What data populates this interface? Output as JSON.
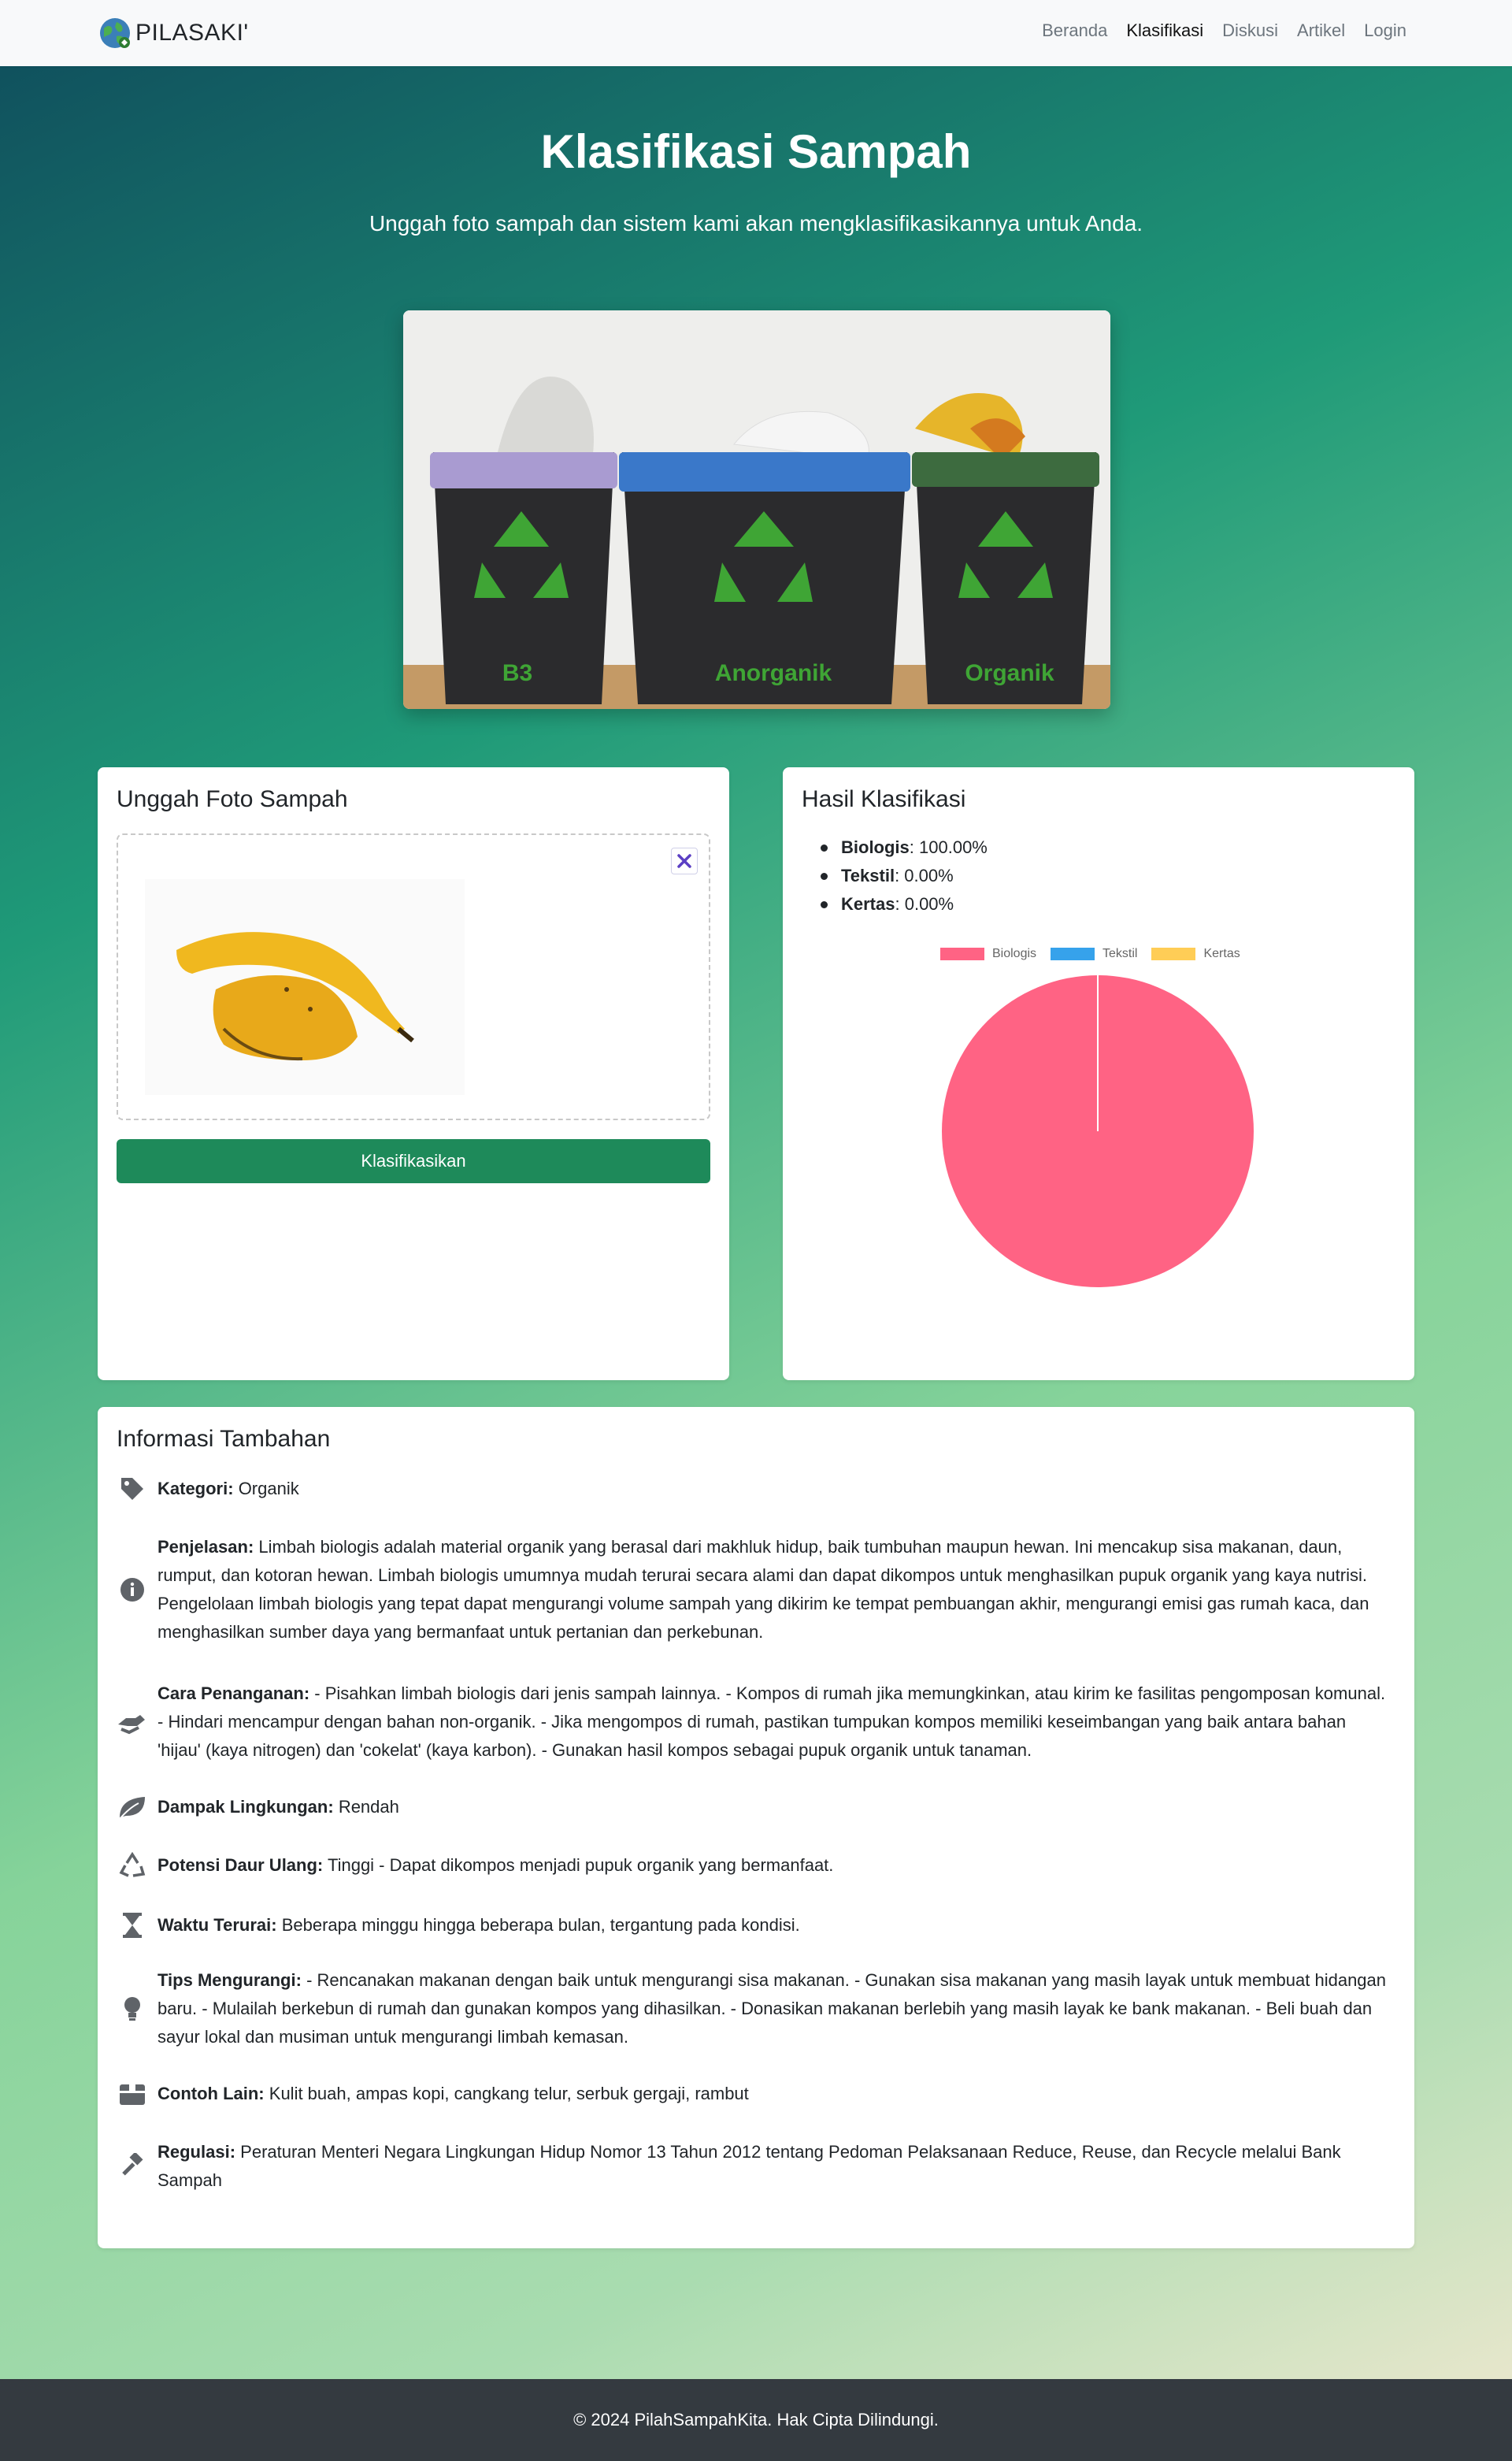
{
  "navbar": {
    "brand": "PILASAKI'",
    "links": [
      {
        "label": "Beranda",
        "active": false
      },
      {
        "label": "Klasifikasi",
        "active": true
      },
      {
        "label": "Diskusi",
        "active": false
      },
      {
        "label": "Artikel",
        "active": false
      },
      {
        "label": "Login",
        "active": false
      }
    ]
  },
  "hero": {
    "title": "Klasifikasi Sampah",
    "subtitle": "Unggah foto sampah dan sistem kami akan mengklasifikasikannya untuk Anda.",
    "bins": [
      "B3",
      "Anorganik",
      "Organik"
    ]
  },
  "upload": {
    "title": "Unggah Foto Sampah",
    "button_label": "Klasifikasikan",
    "clear_icon": "close-icon"
  },
  "result": {
    "title": "Hasil Klasifikasi",
    "items": [
      {
        "label": "Biologis",
        "value": "100.00%"
      },
      {
        "label": "Tekstil",
        "value": "0.00%"
      },
      {
        "label": "Kertas",
        "value": "0.00%"
      }
    ]
  },
  "chart_data": {
    "type": "pie",
    "categories": [
      "Biologis",
      "Tekstil",
      "Kertas"
    ],
    "values": [
      100,
      0,
      0
    ],
    "colors": [
      "#ff6384",
      "#36a2eb",
      "#ffcd56"
    ],
    "legend": "top"
  },
  "info": {
    "title": "Informasi Tambahan",
    "rows": [
      {
        "icon": "tag-icon",
        "label": "Kategori:",
        "text": "Organik"
      },
      {
        "icon": "info-icon",
        "label": "Penjelasan:",
        "text": "Limbah biologis adalah material organik yang berasal dari makhluk hidup, baik tumbuhan maupun hewan. Ini mencakup sisa makanan, daun, rumput, dan kotoran hewan. Limbah biologis umumnya mudah terurai secara alami dan dapat dikompos untuk menghasilkan pupuk organik yang kaya nutrisi. Pengelolaan limbah biologis yang tepat dapat mengurangi volume sampah yang dikirim ke tempat pembuangan akhir, mengurangi emisi gas rumah kaca, dan menghasilkan sumber daya yang bermanfaat untuk pertanian dan perkebunan."
      },
      {
        "icon": "hands-icon",
        "label": "Cara Penanganan:",
        "text": "- Pisahkan limbah biologis dari jenis sampah lainnya. - Kompos di rumah jika memungkinkan, atau kirim ke fasilitas pengomposan komunal. - Hindari mencampur dengan bahan non-organik. - Jika mengompos di rumah, pastikan tumpukan kompos memiliki keseimbangan yang baik antara bahan 'hijau' (kaya nitrogen) dan 'cokelat' (kaya karbon). - Gunakan hasil kompos sebagai pupuk organik untuk tanaman."
      },
      {
        "icon": "leaf-icon",
        "label": "Dampak Lingkungan:",
        "text": "Rendah"
      },
      {
        "icon": "recycle-icon",
        "label": "Potensi Daur Ulang:",
        "text": "Tinggi - Dapat dikompos menjadi pupuk organik yang bermanfaat."
      },
      {
        "icon": "hourglass-icon",
        "label": "Waktu Terurai:",
        "text": "Beberapa minggu hingga beberapa bulan, tergantung pada kondisi."
      },
      {
        "icon": "lightbulb-icon",
        "label": "Tips Mengurangi:",
        "text": "- Rencanakan makanan dengan baik untuk mengurangi sisa makanan. - Gunakan sisa makanan yang masih layak untuk membuat hidangan baru. - Mulailah berkebun di rumah dan gunakan kompos yang dihasilkan. - Donasikan makanan berlebih yang masih layak ke bank makanan. - Beli buah dan sayur lokal dan musiman untuk mengurangi limbah kemasan."
      },
      {
        "icon": "box-icon",
        "label": "Contoh Lain:",
        "text": "Kulit buah, ampas kopi, cangkang telur, serbuk gergaji, rambut"
      },
      {
        "icon": "gavel-icon",
        "label": "Regulasi:",
        "text": "Peraturan Menteri Negara Lingkungan Hidup Nomor 13 Tahun 2012 tentang Pedoman Pelaksanaan Reduce, Reuse, dan Recycle melalui Bank Sampah"
      }
    ]
  },
  "footer": {
    "text": "© 2024 PilahSampahKita. Hak Cipta Dilindungi."
  }
}
